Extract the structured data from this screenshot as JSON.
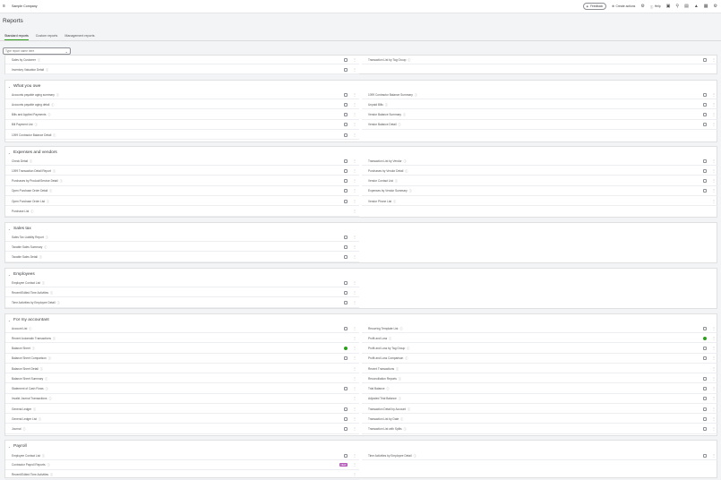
{
  "topbar": {
    "company": "Sample Company",
    "feedback_label": "Feedback",
    "create_label": "Create actions",
    "help_label": "Help"
  },
  "page_title": "Reports",
  "tabs": [
    "Standard reports",
    "Custom reports",
    "Management reports"
  ],
  "search": {
    "placeholder": "Type report name here"
  },
  "top_card": {
    "left": [
      "Sales by Customer",
      "Inventory Valuation Detail"
    ],
    "right": [
      "Transaction List by Tag Group"
    ]
  },
  "sections": [
    {
      "title": "What you owe",
      "left": [
        "Accounts payable aging summary",
        "Accounts payable aging detail",
        "Bills and Applied Payments",
        "Bill Payment List",
        "1099 Contractor Balance Detail"
      ],
      "right": [
        "1099 Contractor Balance Summary",
        "Unpaid Bills",
        "Vendor Balance Summary",
        "Vendor Balance Detail"
      ]
    },
    {
      "title": "Expenses and vendors",
      "left": [
        "Check Detail",
        "1099 Transaction Detail Report",
        "Purchases by Product/Service Detail",
        "Open Purchase Order Detail",
        "Open Purchase Order List",
        "Purchase List"
      ],
      "right": [
        "Transaction List by Vendor",
        "Purchases by Vendor Detail",
        "Vendor Contact List",
        "Expenses by Vendor Summary",
        "Vendor Phone List"
      ]
    },
    {
      "title": "Sales tax",
      "left": [
        "Sales Tax Liability Report",
        "Taxable Sales Summary",
        "Taxable Sales Detail"
      ],
      "right": []
    },
    {
      "title": "Employees",
      "left": [
        "Employee Contact List",
        "Recent/Edited Time Activities",
        "Time Activities by Employee Detail"
      ],
      "right": []
    },
    {
      "title": "For my accountant",
      "left": [
        "Account List",
        "Recent Automatic Transactions",
        "Balance Sheet",
        "Balance Sheet Comparison",
        "Balance Sheet Detail",
        "Balance Sheet Summary",
        "Statement of Cash Flows",
        "Invalid Journal Transactions",
        "General Ledger",
        "General Ledger List",
        "Journal"
      ],
      "right": [
        "Recurring Template List",
        "Profit and Loss",
        "Profit and Loss by Tag Group",
        "Profit and Loss Comparison",
        "Recent Transactions",
        "Reconciliation Reports",
        "Trial Balance",
        "Adjusted Trial Balance",
        "Transaction Detail by Account",
        "Transaction List by Date",
        "Transaction List with Splits"
      ]
    },
    {
      "title": "Payroll",
      "left": [
        "Employee Contact List",
        "Contractor Payroll Reports",
        "Recent/Edited Time Activities"
      ],
      "right": [
        "Time Activities by Employee Detail"
      ],
      "new_badge": "NEW"
    }
  ]
}
